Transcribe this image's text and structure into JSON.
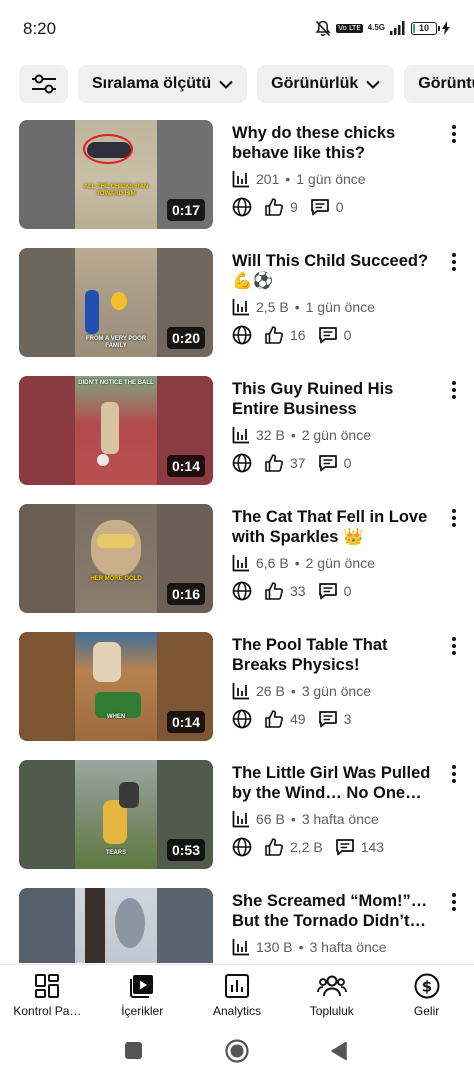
{
  "status": {
    "time": "8:20",
    "network": "4.5G",
    "lte": "Vo LTE",
    "battery": "10",
    "battery_level": 0.1
  },
  "filters": [
    {
      "label": "",
      "icon": "filter-sliders-icon"
    },
    {
      "label": "Sıralama ölçütü",
      "icon": "chevron-down-icon"
    },
    {
      "label": "Görünürlük",
      "icon": "chevron-down-icon"
    },
    {
      "label": "Görüntü",
      "icon": ""
    }
  ],
  "videos": [
    {
      "title": "Why do these chicks behave like this?",
      "duration": "0:17",
      "views": "201",
      "age": "1 gün önce",
      "likes": "9",
      "comments": "0",
      "caption": "ALL THE CHICKS RAN TOWARD HIM",
      "visibility_icon": "globe-icon"
    },
    {
      "title": "Will This Child Succeed? 💪⚽",
      "duration": "0:20",
      "views": "2,5 B",
      "age": "1 gün önce",
      "likes": "16",
      "comments": "0",
      "caption": "FROM A VERY POOR FAMILY",
      "visibility_icon": "globe-icon"
    },
    {
      "title": "This Guy Ruined His Entire Business",
      "duration": "0:14",
      "views": "32 B",
      "age": "2 gün önce",
      "likes": "37",
      "comments": "0",
      "caption": "DIDN'T NOTICE THE BALL",
      "visibility_icon": "globe-icon"
    },
    {
      "title": "The Cat That Fell in Love with Sparkles 👑",
      "duration": "0:16",
      "views": "6,6 B",
      "age": "2 gün önce",
      "likes": "33",
      "comments": "0",
      "caption": "HER MORE GOLD",
      "visibility_icon": "globe-icon"
    },
    {
      "title": "The Pool Table That Breaks Physics!",
      "duration": "0:14",
      "views": "26 B",
      "age": "3 gün önce",
      "likes": "49",
      "comments": "3",
      "caption": "WHEN",
      "visibility_icon": "globe-icon"
    },
    {
      "title": "The Little Girl Was Pulled by the Wind… No One Cou…",
      "duration": "0:53",
      "views": "66 B",
      "age": "3 hafta önce",
      "likes": "2,2 B",
      "comments": "143",
      "caption": "TEARS",
      "visibility_icon": "globe-icon"
    },
    {
      "title": "She Screamed “Mom!”… But the Tornado Didn’t He…",
      "duration": "",
      "views": "130 B",
      "age": "3 hafta önce",
      "likes": "",
      "comments": "",
      "caption": "",
      "visibility_icon": "globe-icon"
    }
  ],
  "bottom_nav": [
    {
      "label": "Kontrol Pa…",
      "icon": "dashboard-icon"
    },
    {
      "label": "İçerikler",
      "icon": "content-icon"
    },
    {
      "label": "Analytics",
      "icon": "analytics-icon"
    },
    {
      "label": "Topluluk",
      "icon": "community-icon"
    },
    {
      "label": "Gelir",
      "icon": "earn-icon"
    }
  ],
  "colors": {
    "text_primary": "#0f0f0f",
    "text_secondary": "#606060",
    "chip_bg": "#f0f0f0",
    "battery_green": "#34a853"
  }
}
